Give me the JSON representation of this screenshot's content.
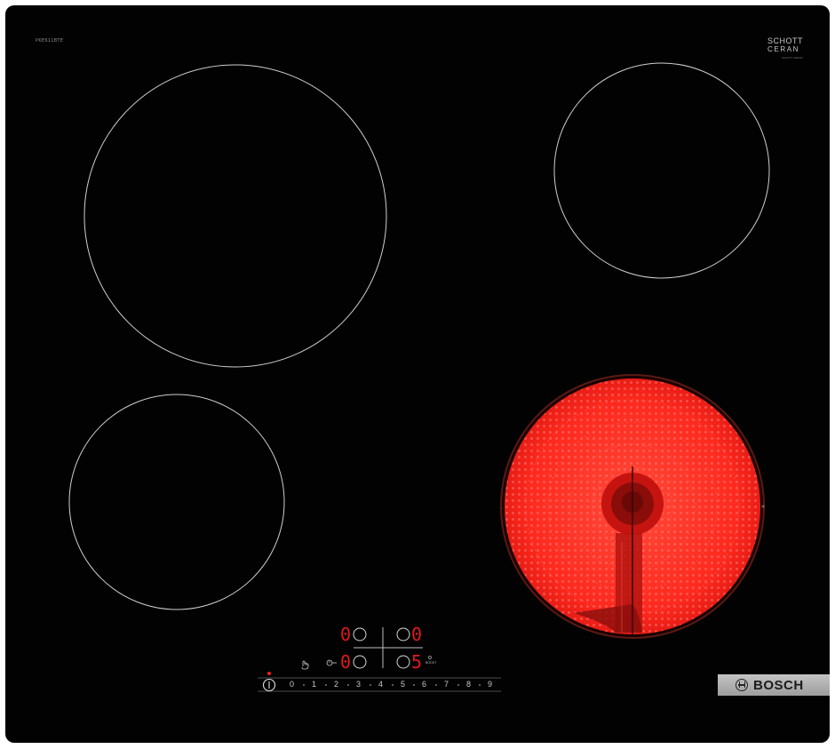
{
  "hob": {
    "model_code": "PKE611BTE",
    "logo": {
      "line1": "SCHOTT",
      "line2": "CERAN",
      "line3": "SCHOTT CERAN"
    },
    "brand": "BOSCH",
    "brand_icon": "bosch-armature-icon",
    "boost_label": "BOOST",
    "colors": {
      "glass": "#020202",
      "zone_outline": "#cfcfcf",
      "heating": "#ff2a1f",
      "display_red": "#e0191a"
    }
  },
  "zones": [
    {
      "name": "front-left",
      "state": "off"
    },
    {
      "name": "rear-left",
      "state": "off"
    },
    {
      "name": "rear-right",
      "state": "off"
    },
    {
      "name": "front-right",
      "state": "on"
    }
  ],
  "displays": {
    "rear_left": "0",
    "rear_right": "0",
    "front_left": "0",
    "front_right": "5"
  },
  "controls": {
    "power_icon": "power-icon",
    "timer_icon": "timer-icon",
    "child_lock_icon": "child-lock-icon",
    "boost_icon": "boost-icon"
  },
  "power_scale": [
    "0",
    "1",
    "2",
    "3",
    "4",
    "5",
    "6",
    "7",
    "8",
    "9"
  ]
}
